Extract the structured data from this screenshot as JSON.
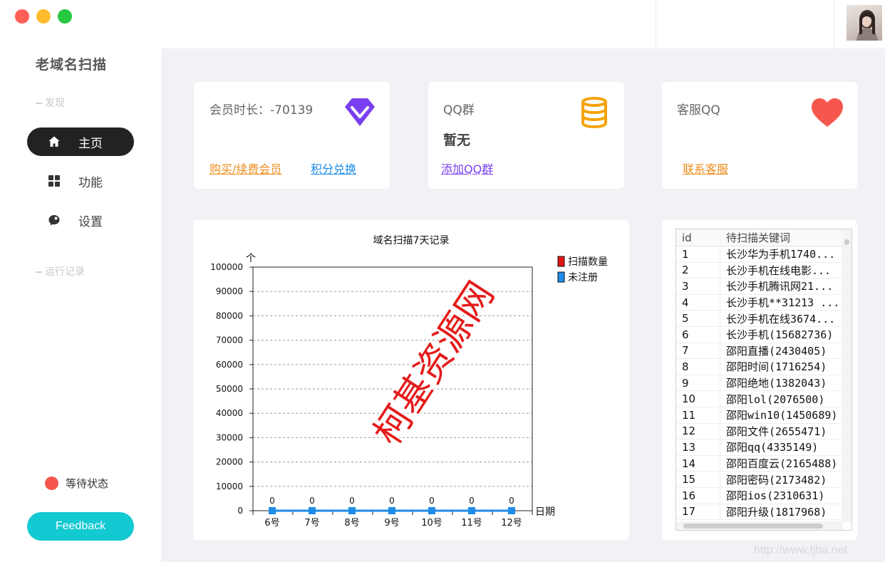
{
  "app": {
    "title": "老域名扫描"
  },
  "sidebar": {
    "section_discover": "发现",
    "items": [
      {
        "label": "主页",
        "icon": "home-icon",
        "active": true
      },
      {
        "label": "功能",
        "icon": "grid-icon",
        "active": false
      },
      {
        "label": "设置",
        "icon": "chat-bubble-icon",
        "active": false
      }
    ],
    "section_log": "运行记录",
    "status_text": "等待状态",
    "feedback_label": "Feedback"
  },
  "cards": {
    "membership": {
      "label": "会员时长：-70139",
      "icon": "diamond-icon",
      "link_buy": "购买/续费会员",
      "link_points": "积分兑换"
    },
    "qq_group": {
      "label": "QQ群",
      "value": "暂无",
      "icon": "database-icon",
      "link": "添加QQ群"
    },
    "support": {
      "label": "客服QQ",
      "icon": "heart-icon",
      "link": "联系客服"
    }
  },
  "colors": {
    "accent_dark": "#222222",
    "feedback": "#13c9d2",
    "status_dot": "#f5574d",
    "scan_series": "#e11414",
    "unregistered_series": "#1e8ce8",
    "diamond": "#7a3ff0",
    "database": "#f5a40a",
    "heart": "#f5574d"
  },
  "chart_data": {
    "type": "line",
    "title": "域名扫描7天记录",
    "xlabel": "日期",
    "ylabel": "个",
    "categories": [
      "6号",
      "7号",
      "8号",
      "9号",
      "10号",
      "11号",
      "12号"
    ],
    "ylim": [
      0,
      100000
    ],
    "yticks": [
      "0",
      "10000",
      "20000",
      "30000",
      "40000",
      "50000",
      "60000",
      "70000",
      "80000",
      "90000",
      "100000"
    ],
    "grid": true,
    "legend_position": "top-right",
    "series": [
      {
        "name": "扫描数量",
        "values": [
          0,
          0,
          0,
          0,
          0,
          0,
          0
        ]
      },
      {
        "name": "未注册",
        "values": [
          0,
          0,
          0,
          0,
          0,
          0,
          0
        ]
      }
    ],
    "data_labels": [
      "0",
      "0",
      "0",
      "0",
      "0",
      "0",
      "0"
    ]
  },
  "watermark": "柯基资源网",
  "table": {
    "headers": [
      "id",
      "待扫描关键词"
    ],
    "rows": [
      [
        "1",
        "长沙华为手机1740..."
      ],
      [
        "2",
        "长沙手机在线电影..."
      ],
      [
        "3",
        "长沙手机腾讯网21..."
      ],
      [
        "4",
        "长沙手机**31213 ..."
      ],
      [
        "5",
        "长沙手机在线3674..."
      ],
      [
        "6",
        "长沙手机(15682736)"
      ],
      [
        "7",
        "邵阳直播(2430405)"
      ],
      [
        "8",
        "邵阳时间(1716254)"
      ],
      [
        "9",
        "邵阳绝地(1382043)"
      ],
      [
        "10",
        "邵阳lol(2076500)"
      ],
      [
        "11",
        "邵阳win10(1450689)"
      ],
      [
        "12",
        "邵阳文件(2655471)"
      ],
      [
        "13",
        "邵阳qq(4335149)"
      ],
      [
        "14",
        "邵阳百度云(2165488)"
      ],
      [
        "15",
        "邵阳密码(2173482)"
      ],
      [
        "16",
        "邵阳ios(2310631)"
      ],
      [
        "17",
        "邵阳升级(1817968)"
      ]
    ]
  },
  "footer_url": "http://www.fjha.net"
}
